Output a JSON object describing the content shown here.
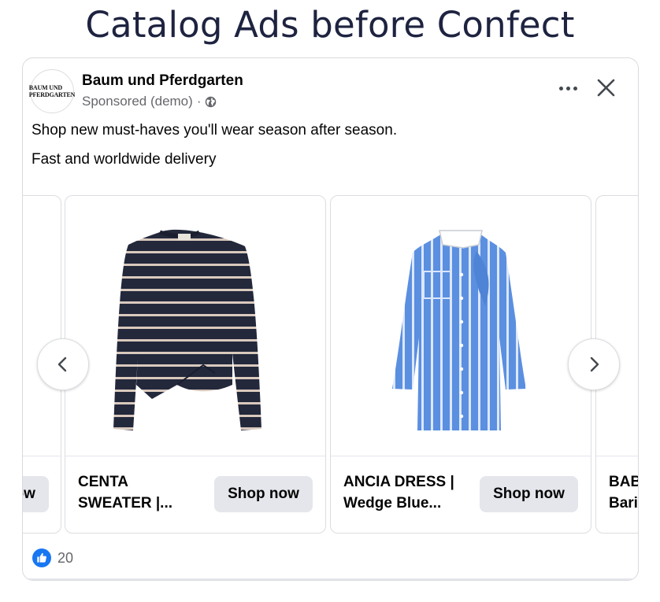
{
  "page": {
    "heading": "Catalog Ads before Confect"
  },
  "post": {
    "avatar_text": "BAUM UND\nPFERDGARTEN",
    "page_name": "Baum und Pferdgarten",
    "sponsored_label": "Sponsored (demo)",
    "separator": "·",
    "body_line1": "Shop new must-haves you'll wear season after season.",
    "body_line2": "Fast and worldwide delivery",
    "icons": {
      "more": "more-options-icon",
      "close": "close-icon",
      "audience": "globe-icon"
    }
  },
  "carousel": {
    "left_partial": {
      "button_label": "Shop now"
    },
    "products": [
      {
        "title": "CENTA\nSWEATER |...",
        "button_label": "Shop now",
        "image": "striped-sweater"
      },
      {
        "title": "ANCIA DRESS |\nWedge Blue...",
        "button_label": "Shop now",
        "image": "striped-shirt-dress"
      }
    ],
    "right_partial": {
      "title": "BABETTE\nBarina"
    },
    "nav": {
      "prev_icon": "chevron-left-icon",
      "next_icon": "chevron-right-icon"
    }
  },
  "reactions": {
    "icon": "like-icon",
    "count": "20"
  },
  "colors": {
    "heading": "#1e2340",
    "like_blue": "#1877f2",
    "button_bg": "#e4e6eb",
    "secondary_text": "#65676b"
  }
}
